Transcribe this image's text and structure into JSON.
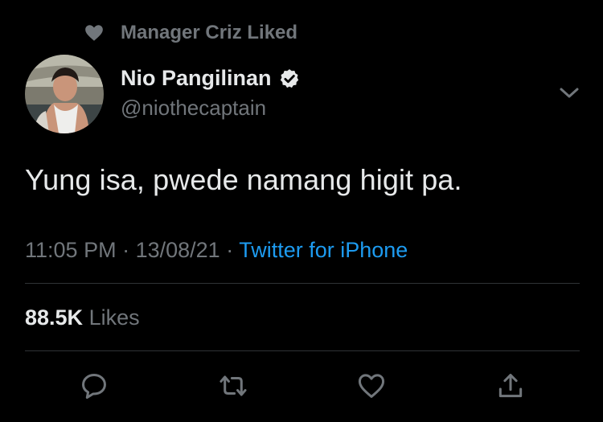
{
  "context": {
    "text": "Manager Criz Liked",
    "icon": "heart-icon"
  },
  "author": {
    "display_name": "Nio Pangilinan",
    "handle": "@niothecaptain",
    "verified": true
  },
  "tweet": {
    "text": "Yung isa, pwede namang higit pa."
  },
  "meta": {
    "time": "11:05 PM",
    "separator1": " · ",
    "date": "13/08/21",
    "separator2": " · ",
    "source": "Twitter for iPhone"
  },
  "stats": {
    "likes_count": "88.5K",
    "likes_label": "Likes"
  },
  "actions": [
    "reply-icon",
    "retweet-icon",
    "like-icon",
    "share-icon"
  ],
  "colors": {
    "background": "#000000",
    "text": "#e7e9ea",
    "muted": "#71767b",
    "link": "#1d9bf0"
  }
}
